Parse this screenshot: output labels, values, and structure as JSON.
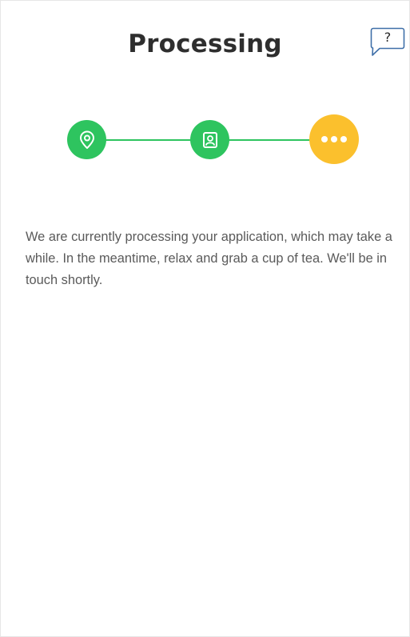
{
  "header": {
    "title": "Processing",
    "help_label": "?"
  },
  "stepper": {
    "steps": [
      {
        "icon": "location-pin-icon",
        "status": "complete",
        "color": "#2ec45f"
      },
      {
        "icon": "profile-id-icon",
        "status": "complete",
        "color": "#2ec45f"
      },
      {
        "icon": "more-dots-icon",
        "status": "in-progress",
        "color": "#fbc02d"
      }
    ],
    "line_color": "#2ec45f"
  },
  "main": {
    "message": "We are currently processing your application, which may take a while. In the meantime, relax and grab a cup of tea. We'll be in touch shortly."
  }
}
